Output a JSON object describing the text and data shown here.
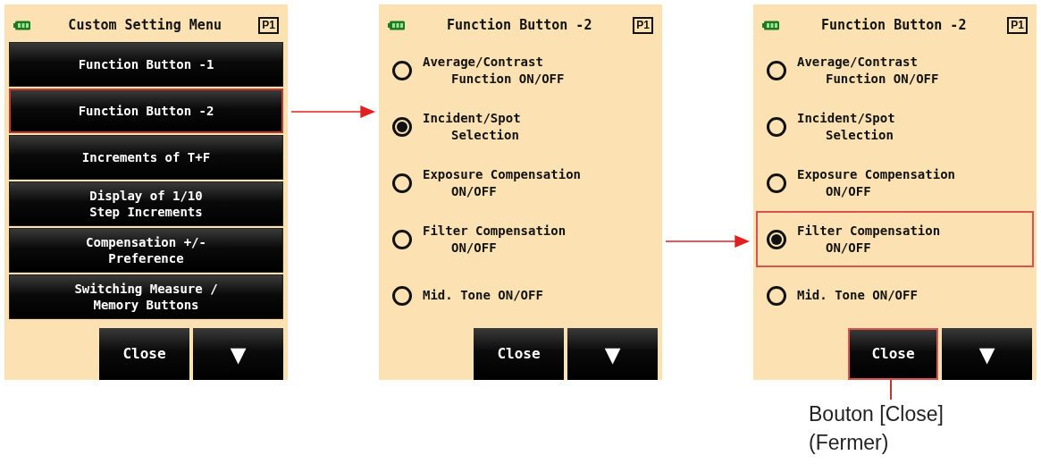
{
  "screens": [
    {
      "kind": "menu",
      "title": "Custom Setting Menu",
      "page": "P1",
      "items": [
        {
          "lines": [
            "Function Button -1"
          ],
          "highlighted": false
        },
        {
          "lines": [
            "Function Button -2"
          ],
          "highlighted": true
        },
        {
          "lines": [
            "Increments of T+F"
          ],
          "highlighted": false
        },
        {
          "lines": [
            "Display of 1/10",
            "Step Increments"
          ],
          "highlighted": false
        },
        {
          "lines": [
            "Compensation +/-",
            "Preference"
          ],
          "highlighted": false
        },
        {
          "lines": [
            "Switching Measure /",
            "Memory Buttons"
          ],
          "highlighted": false
        }
      ],
      "close": {
        "label": "Close",
        "highlighted": false
      },
      "down": "▼"
    },
    {
      "kind": "options",
      "title": "Function Button -2",
      "page": "P1",
      "items": [
        {
          "lines": [
            "Average/Contrast",
            "Function ON/OFF"
          ],
          "selected": false,
          "highlighted": false
        },
        {
          "lines": [
            "Incident/Spot",
            "Selection"
          ],
          "selected": true,
          "highlighted": false
        },
        {
          "lines": [
            "Exposure Compensation",
            "ON/OFF"
          ],
          "selected": false,
          "highlighted": false
        },
        {
          "lines": [
            "Filter Compensation",
            "ON/OFF"
          ],
          "selected": false,
          "highlighted": false
        },
        {
          "lines": [
            "Mid. Tone ON/OFF"
          ],
          "selected": false,
          "highlighted": false
        }
      ],
      "close": {
        "label": "Close",
        "highlighted": false
      },
      "down": "▼"
    },
    {
      "kind": "options",
      "title": "Function Button -2",
      "page": "P1",
      "items": [
        {
          "lines": [
            "Average/Contrast",
            "Function ON/OFF"
          ],
          "selected": false,
          "highlighted": false
        },
        {
          "lines": [
            "Incident/Spot",
            "Selection"
          ],
          "selected": false,
          "highlighted": false
        },
        {
          "lines": [
            "Exposure Compensation",
            "ON/OFF"
          ],
          "selected": false,
          "highlighted": false
        },
        {
          "lines": [
            "Filter Compensation",
            "ON/OFF"
          ],
          "selected": true,
          "highlighted": true
        },
        {
          "lines": [
            "Mid. Tone ON/OFF"
          ],
          "selected": false,
          "highlighted": false
        }
      ],
      "close": {
        "label": "Close",
        "highlighted": true
      },
      "down": "▼"
    }
  ],
  "callout": {
    "lines": [
      "Bouton [Close]",
      "(Fermer)"
    ]
  }
}
